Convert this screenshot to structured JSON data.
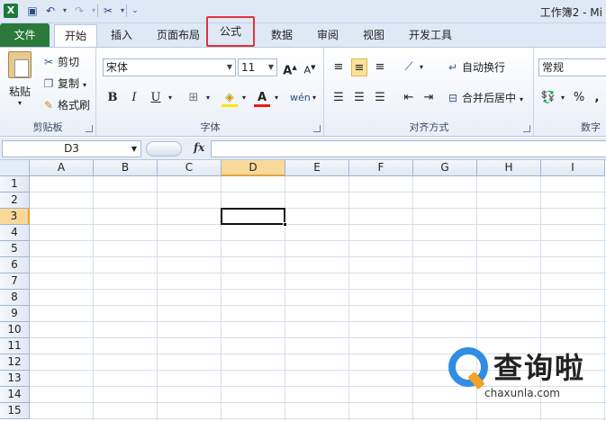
{
  "window": {
    "title": "工作簿2 - Mi"
  },
  "tabs": [
    {
      "label": "文件",
      "kind": "file"
    },
    {
      "label": "开始",
      "kind": "active"
    },
    {
      "label": "插入",
      "kind": "normal"
    },
    {
      "label": "页面布局",
      "kind": "normal"
    },
    {
      "label": "公式",
      "kind": "highlight"
    },
    {
      "label": "数据",
      "kind": "normal"
    },
    {
      "label": "审阅",
      "kind": "normal"
    },
    {
      "label": "视图",
      "kind": "normal"
    },
    {
      "label": "开发工具",
      "kind": "normal"
    }
  ],
  "clipboard": {
    "paste_label": "粘贴",
    "cut_label": "剪切",
    "copy_label": "复制",
    "format_painter_label": "格式刷",
    "group_label": "剪贴板"
  },
  "font": {
    "font_name": "宋体",
    "font_size": "11",
    "bold": "B",
    "italic": "I",
    "underline": "U",
    "group_label": "字体"
  },
  "alignment": {
    "wrap_text_label": "自动换行",
    "merge_center_label": "合并后居中",
    "group_label": "对齐方式"
  },
  "number": {
    "format_value": "常规",
    "percent": "%",
    "comma": ",",
    "group_label": "数字"
  },
  "formula_bar": {
    "name_box": "D3",
    "fx_label": "fx"
  },
  "sheet": {
    "columns": [
      "A",
      "B",
      "C",
      "D",
      "E",
      "F",
      "G",
      "H",
      "I"
    ],
    "rows": [
      "1",
      "2",
      "3",
      "4",
      "5",
      "6",
      "7",
      "8",
      "9",
      "10",
      "11",
      "12",
      "13",
      "14",
      "15"
    ],
    "active_column": "D",
    "active_row": "3"
  },
  "watermark": {
    "text": "查询啦",
    "url": "chaxunla.com"
  },
  "colors": {
    "file_tab": "#2b7a3c",
    "highlight_box": "#d9373a",
    "selection_header": "#f9d99a"
  }
}
